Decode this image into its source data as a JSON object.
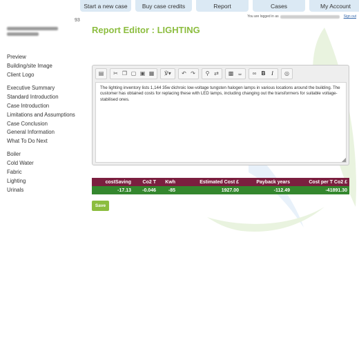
{
  "colors": {
    "accent_green": "#8cbd3f",
    "header_maroon": "#7b1f3f",
    "row_green": "#34872e",
    "nav_blue": "#dbe9f4"
  },
  "nav": [
    {
      "label": "Start a new case"
    },
    {
      "label": "Buy case credits"
    },
    {
      "label": "Report"
    },
    {
      "label": "Cases"
    },
    {
      "label": "My Account"
    }
  ],
  "login": {
    "prefix": "You are logged in as",
    "signout": "Sign out"
  },
  "case": {
    "number": "93"
  },
  "sidebar": {
    "group1": [
      "Preview",
      "Building/site Image",
      "Client Logo"
    ],
    "group2": [
      "Executive Summary",
      "Standard Introduction",
      "Case Introduction",
      "Limitations and Assumptions",
      "Case Conclusion",
      "General Information",
      "What To Do Next"
    ],
    "group3": [
      "Boiler",
      "Cold Water",
      "Fabric",
      "Lighting",
      "Urinals"
    ]
  },
  "page": {
    "title": "Report Editor : LIGHTING"
  },
  "editor": {
    "toolbar_icons": [
      "source-icon",
      "cut-icon",
      "copy-icon",
      "paste-icon",
      "paste-text-icon",
      "paste-word-icon",
      "spellcheck-icon",
      "undo-icon",
      "redo-icon",
      "find-icon",
      "replace-icon",
      "select-all-icon",
      "remove-format-icon",
      "link-icon",
      "bold-icon",
      "italic-icon",
      "image-icon"
    ],
    "content": "The lighting inventory lists 1,144 35w dichroic low-voltage tungsten halogen lamps in various locations around the building. The customer has obtained costs for replacing these with LED lamps, including changing out the transformers for suitable voltage-stabilised ones."
  },
  "results": {
    "headers": [
      "costSaving",
      "Co2 T",
      "Kwh",
      "Estimated Cost £",
      "Payback years",
      "Cost per T Co2 £"
    ],
    "values": [
      "-17.13",
      "-0.046",
      "-85",
      "1927.00",
      "-112.49",
      "-41891.30"
    ]
  },
  "save": {
    "label": "Save"
  }
}
